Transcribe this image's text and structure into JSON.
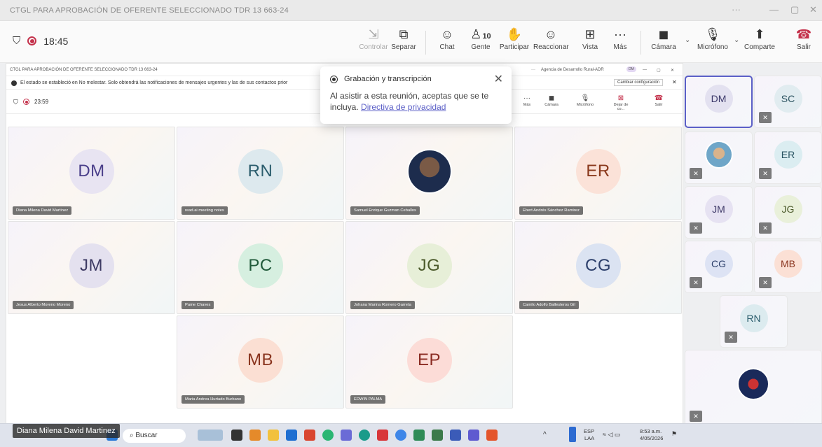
{
  "window": {
    "title": "CTGL PARA APROBACIÓN DE OFERENTE SELECCIONADO TDR 13 663-24",
    "controls": [
      "···",
      "—",
      "▢",
      "✕"
    ]
  },
  "toolbar": {
    "time": "18:45",
    "buttons": [
      {
        "label": "Controlar",
        "icon": "share-control-icon"
      },
      {
        "label": "Separar",
        "icon": "popout-icon"
      },
      {
        "label": "Chat",
        "icon": "chat-icon"
      },
      {
        "label": "Gente",
        "icon": "people-icon",
        "count": "10"
      },
      {
        "label": "Participar",
        "icon": "raise-hand-icon"
      },
      {
        "label": "Reaccionar",
        "icon": "smiley-icon"
      },
      {
        "label": "Vista",
        "icon": "view-icon"
      },
      {
        "label": "Más",
        "icon": "more-icon"
      },
      {
        "label": "Cámara",
        "icon": "camera-off-icon"
      },
      {
        "label": "Micrófono",
        "icon": "mic-off-icon"
      },
      {
        "label": "Comparte",
        "icon": "share-icon"
      },
      {
        "label": "Salir",
        "icon": "hangup-icon"
      }
    ]
  },
  "inner": {
    "title": "CTGL PARA APROBACIÓN DE OFERENTE SELECCIONADO TDR 13 663-24",
    "org": "Agencia de Desarrollo Rural-ADR",
    "org_badge": "DM",
    "notice": "El estado se estableció en No molestar. Solo obtendrá las notificaciones de mensajes urgentes y las de sus contactos prior",
    "notice_button": "Cambiar configuración",
    "time": "23:59",
    "mini_buttons": [
      "Más",
      "Cámara",
      "Micrófono",
      "Dejar de co...",
      "Salir"
    ]
  },
  "popup": {
    "title": "Grabación y transcripción",
    "text": "Al asistir a esta reunión, aceptas que se te incluya.",
    "link": "Directiva de privacidad"
  },
  "grid": [
    {
      "initials": "DM",
      "name": "Diana Milena David Martinez",
      "bg": "#e8e4f2",
      "color": "#4a3f8a"
    },
    {
      "initials": "RN",
      "name": "read.ai meeting notes",
      "bg": "#dde9ee",
      "color": "#2b5d6d"
    },
    {
      "initials": "",
      "name": "Samuel Enrique Guzman Ceballos",
      "bg": "#ffffff",
      "color": "#000000",
      "photo": true
    },
    {
      "initials": "ER",
      "name": "Ebert Andrés Sánchez Ramirez",
      "bg": "#fbe2d8",
      "color": "#8a3a1d"
    },
    {
      "initials": "JM",
      "name": "Jesus Alberto Moreno Moreno",
      "bg": "#e4e1ef",
      "color": "#3d3a63"
    },
    {
      "initials": "PC",
      "name": "Pame Chaves",
      "bg": "#d6efe0",
      "color": "#205a3a"
    },
    {
      "initials": "JG",
      "name": "Johana Marina Romero Garreta",
      "bg": "#e7efd8",
      "color": "#4b5a2b"
    },
    {
      "initials": "CG",
      "name": "Camilo Adolfo Ballesteros Gil",
      "bg": "#dbe3f2",
      "color": "#2c3f6b"
    },
    {
      "initials": "MB",
      "name": "Maria Andrea Hurtado Burbano",
      "bg": "#fbdfd3",
      "color": "#8a351f"
    },
    {
      "initials": "EP",
      "name": "EDWIN PALMA",
      "bg": "#fcdcd7",
      "color": "#8b2d24"
    }
  ],
  "side": [
    {
      "initials": "DM",
      "bg": "#e3e1f0",
      "color": "#3d3a6b",
      "active": true
    },
    {
      "initials": "SC",
      "bg": "#e1ecf0",
      "color": "#2c5360"
    },
    {
      "initials": "",
      "bg": "#ffffff",
      "color": "#000000",
      "photo": true
    },
    {
      "initials": "ER",
      "bg": "#dbedf1",
      "color": "#2a5563"
    },
    {
      "initials": "JM",
      "bg": "#e6e2f2",
      "color": "#3f3a68"
    },
    {
      "initials": "JG",
      "bg": "#e9f0da",
      "color": "#4b5a2b"
    },
    {
      "initials": "CG",
      "bg": "#dde3f4",
      "color": "#2c3f6b"
    },
    {
      "initials": "MB",
      "bg": "#fbe0d5",
      "color": "#8a351f"
    },
    {
      "initials": "RN",
      "bg": "#dcebef",
      "color": "#2b5d6d"
    },
    {
      "initials": "",
      "bg": "#ffffff",
      "color": "#000000",
      "photo": true
    }
  ],
  "speaker": "Diana Milena David Martinez",
  "taskbar": {
    "search": "Buscar",
    "lang1": "ESP",
    "lang2": "LAA",
    "clock": "8:53 a.m.",
    "date": "4/05/2026"
  }
}
